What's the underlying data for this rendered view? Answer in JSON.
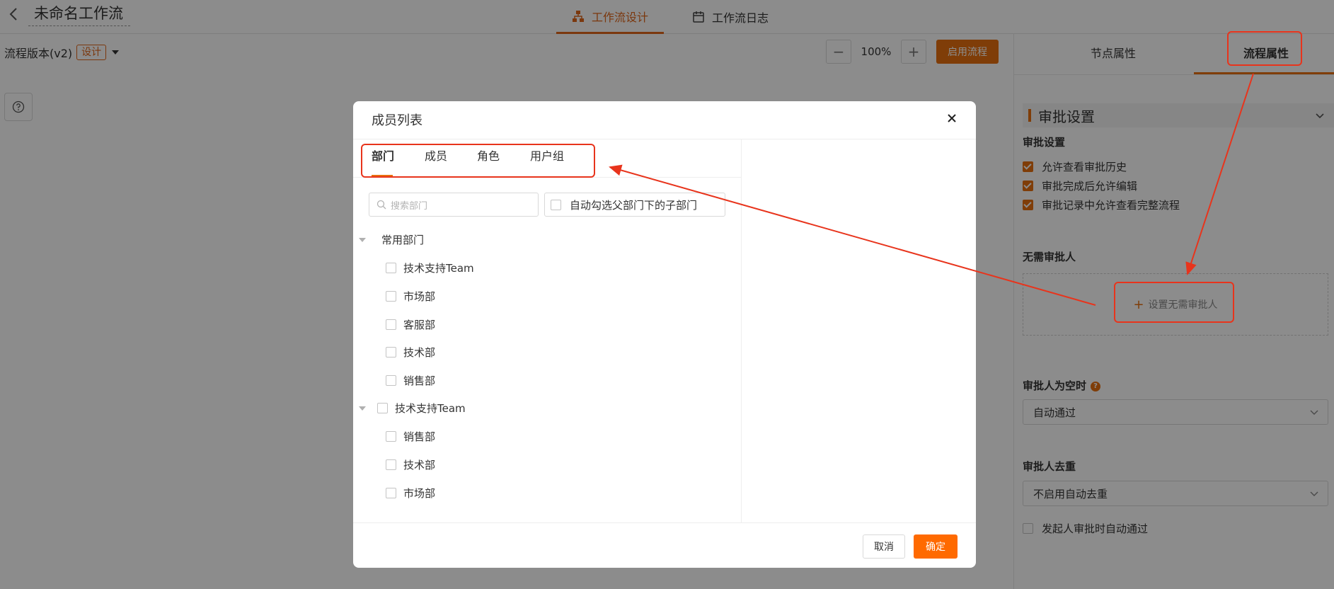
{
  "header": {
    "title": "未命名工作流",
    "tabs": [
      {
        "label": "工作流设计",
        "icon": "org-chart-icon"
      },
      {
        "label": "工作流日志",
        "icon": "calendar-icon"
      }
    ]
  },
  "toolbar": {
    "version_label": "流程版本(v2)",
    "version_badge": "设计",
    "zoom_minus": "−",
    "zoom_level": "100%",
    "zoom_plus": "+",
    "enable_label": "启用流程"
  },
  "right_panel": {
    "tabs": [
      "节点属性",
      "流程属性"
    ],
    "active_tab": "流程属性",
    "section_title": "审批设置",
    "approval_label": "审批设置",
    "checks": [
      "允许查看审批历史",
      "审批完成后允许编辑",
      "审批记录中允许查看完整流程"
    ],
    "no_approver_label": "无需审批人",
    "no_approver_button": "设置无需审批人",
    "empty_label": "审批人为空时",
    "empty_value": "自动通过",
    "dedupe_label": "审批人去重",
    "dedupe_value": "不启用自动去重",
    "auto_pass_label": "发起人审批时自动通过"
  },
  "modal": {
    "title": "成员列表",
    "tabs": [
      "部门",
      "成员",
      "角色",
      "用户组"
    ],
    "active_tab": "部门",
    "search_placeholder": "搜索部门",
    "auto_check_label": "自动勾选父部门下的子部门",
    "groups": [
      {
        "name": "常用部门",
        "items": [
          "技术支持Team",
          "市场部",
          "客服部",
          "技术部",
          "销售部"
        ]
      },
      {
        "name": "技术支持Team",
        "items": [
          "销售部",
          "技术部",
          "市场部"
        ]
      }
    ],
    "cancel_label": "取消",
    "ok_label": "确定"
  },
  "colors": {
    "accent": "#e8700f",
    "primary_button": "#ff6a00",
    "annotation": "#e8341c"
  }
}
